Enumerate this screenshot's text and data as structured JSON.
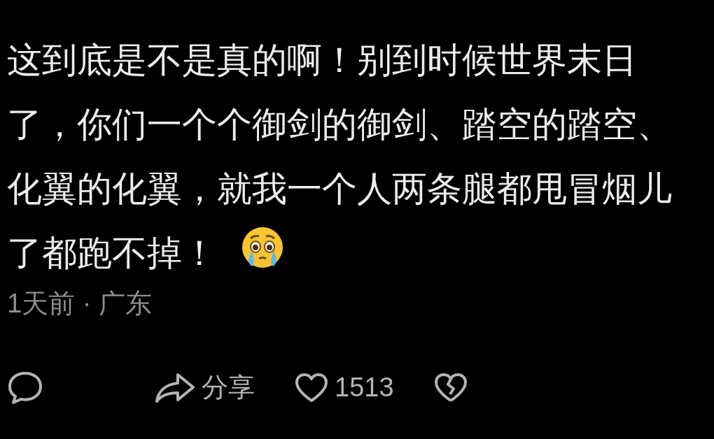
{
  "comment": {
    "text": "这到底是不是真的啊！别到时候世界末日了，你们一个个御剑的御剑、踏空的踏空、化翼的化翼，就我一个人两条腿都甩冒烟儿了都跑不掉！",
    "meta": "1天前 · 广东"
  },
  "actions": {
    "share_label": "分享",
    "like_count": "1513"
  }
}
